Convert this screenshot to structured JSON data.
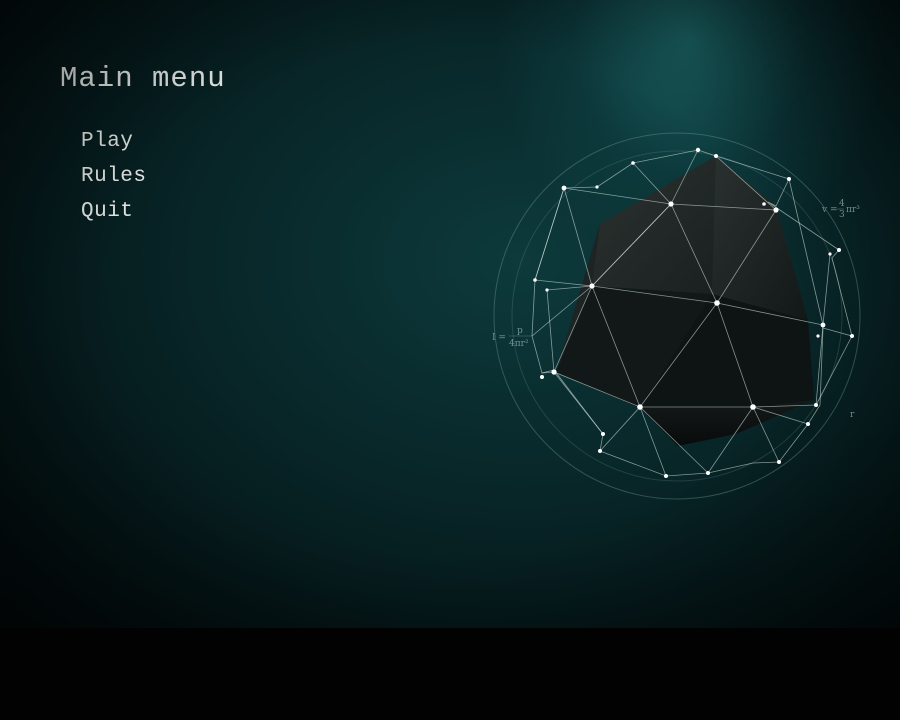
{
  "menu": {
    "title": "Main menu",
    "items": [
      {
        "label": "Play"
      },
      {
        "label": "Rules"
      },
      {
        "label": "Quit"
      }
    ]
  },
  "artwork": {
    "formula_left_prefix": "I =",
    "formula_left_num": "p",
    "formula_left_den": "4πr²",
    "formula_right_prefix": "v =",
    "formula_right_num": "4",
    "formula_right_den": "3",
    "formula_right_suffix": "πr³",
    "radius_label": "r"
  },
  "colors": {
    "background_center": "#0d3a3c",
    "background_edge": "#020a0b",
    "text": "#e3e7e4",
    "bottom_bar": "#020202"
  }
}
